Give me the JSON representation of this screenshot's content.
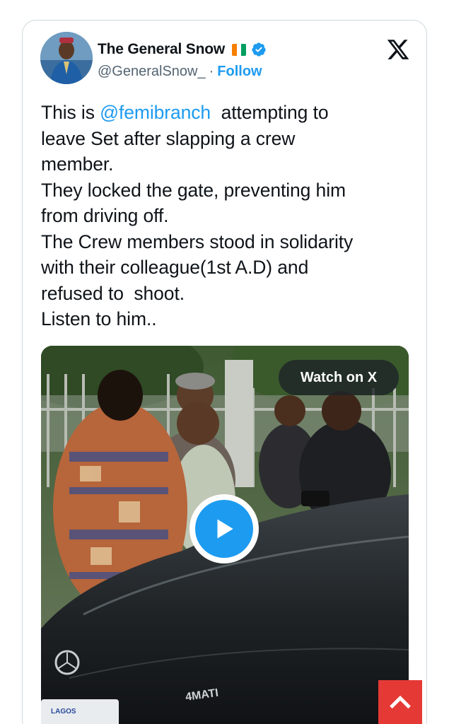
{
  "tweet": {
    "author": {
      "name": "The General Snow",
      "handle": "@GeneralSnow_",
      "separator": "·",
      "follow_label": "Follow",
      "avatar_icon": "profile-avatar",
      "flag_colors": [
        "#f77f00",
        "#ffffff",
        "#009e60"
      ],
      "verified_color": "#1d9bf0"
    },
    "logo_icon": "x-logo-icon",
    "text": {
      "line1_prefix": "This is ",
      "line1_mention": "@femibranch",
      "line1_suffix": "  attempting to",
      "line2": "leave Set after slapping a crew",
      "line3": "member.",
      "line4": "They locked the gate, preventing him",
      "line5": "from driving off.",
      "line6": "The Crew members stood in solidarity",
      "line7": "with their colleague(1st A.D) and",
      "line8": "refused to  shoot.",
      "line9": "Listen to him.."
    },
    "media": {
      "watch_label": "Watch on X",
      "play_icon": "play-icon",
      "accent_color": "#1d9bf0",
      "car_badge": "4MATI",
      "plate_text": "LAGOS"
    }
  },
  "scroll_top": {
    "icon": "chevron-up-icon",
    "color": "#e53935"
  }
}
